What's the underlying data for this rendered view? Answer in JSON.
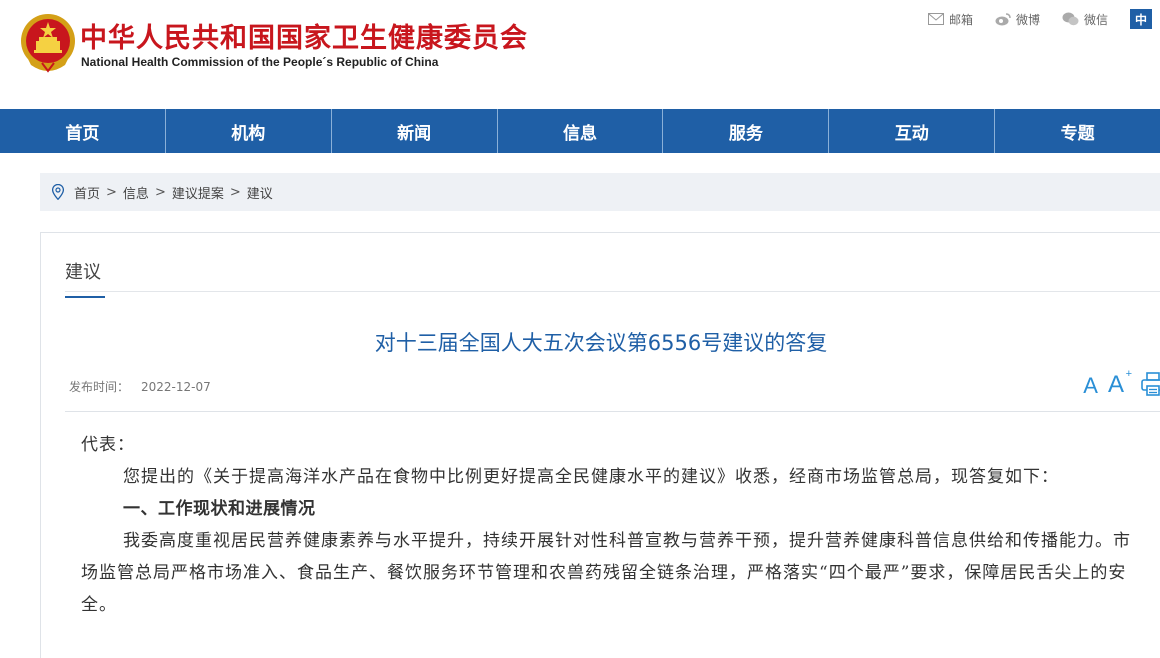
{
  "header": {
    "title_cn": "中华人民共和国国家卫生健康委员会",
    "title_en": "National Health Commission of the People´s Republic of China",
    "links": [
      {
        "label": "邮箱",
        "icon": "mail-icon"
      },
      {
        "label": "微博",
        "icon": "weibo-icon"
      },
      {
        "label": "微信",
        "icon": "wechat-icon"
      }
    ],
    "lang": "中"
  },
  "nav": [
    "首页",
    "机构",
    "新闻",
    "信息",
    "服务",
    "互动",
    "专题"
  ],
  "breadcrumb": [
    "首页",
    "信息",
    "建议提案",
    "建议"
  ],
  "section": {
    "tab": "建议"
  },
  "article": {
    "title": "对十三届全国人大五次会议第6556号建议的答复",
    "pub_label": "发布时间：",
    "pub_date": "2022-12-07",
    "font_decrease": "A",
    "font_increase": "A",
    "font_increase_sup": "+",
    "salutation": "代表：",
    "para1": "您提出的《关于提高海洋水产品在食物中比例更好提高全民健康水平的建议》收悉，经商市场监管总局，现答复如下：",
    "heading1": "一、工作现状和进展情况",
    "para2": "我委高度重视居民营养健康素养与水平提升，持续开展针对性科普宣教与营养干预，提升营养健康科普信息供给和传播能力。市场监管总局严格市场准入、食品生产、餐饮服务环节管理和农兽药残留全链条治理，严格落实“四个最严”要求，保障居民舌尖上的安全。"
  },
  "colors": {
    "brand_red": "#c8161d",
    "nav_blue": "#1f5fa6",
    "tool_blue": "#2a8fd6"
  }
}
